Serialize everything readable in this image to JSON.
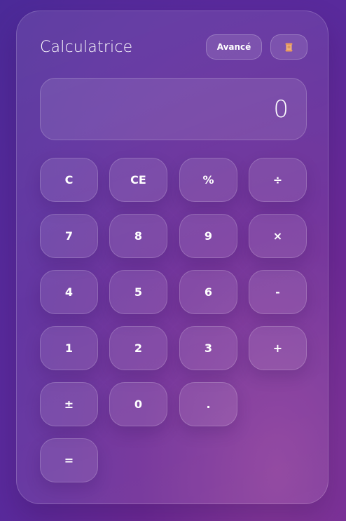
{
  "app": {
    "title": "Calculatrice"
  },
  "header": {
    "advanced_label": "Avancé",
    "history_icon": "scroll-icon"
  },
  "display": {
    "value": "0"
  },
  "keys": {
    "clear": "C",
    "clear_entry": "CE",
    "percent": "%",
    "divide": "÷",
    "seven": "7",
    "eight": "8",
    "nine": "9",
    "multiply": "×",
    "four": "4",
    "five": "5",
    "six": "6",
    "subtract": "-",
    "one": "1",
    "two": "2",
    "three": "3",
    "add": "+",
    "plus_minus": "±",
    "zero": "0",
    "decimal": ".",
    "equals": "="
  },
  "colors": {
    "background_top": "#4b2a98",
    "background_bottom": "#8a3a9a",
    "text": "#ffffff",
    "history_icon": "#f0b27a"
  }
}
